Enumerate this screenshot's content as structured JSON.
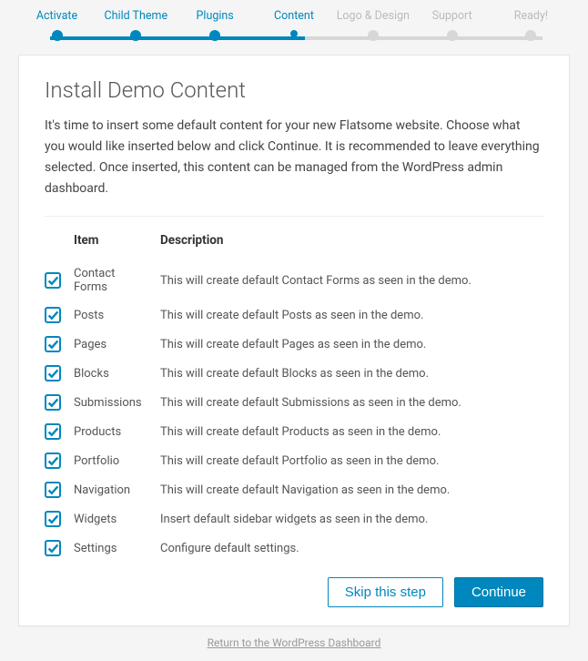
{
  "steps": [
    {
      "label": "Activate",
      "state": "done"
    },
    {
      "label": "Child Theme",
      "state": "done"
    },
    {
      "label": "Plugins",
      "state": "done"
    },
    {
      "label": "Content",
      "state": "active"
    },
    {
      "label": "Logo & Design",
      "state": "pending"
    },
    {
      "label": "Support",
      "state": "pending"
    },
    {
      "label": "Ready!",
      "state": "pending"
    }
  ],
  "title": "Install Demo Content",
  "intro": "It's time to insert some default content for your new Flatsome website. Choose what you would like inserted below and click Continue. It is recommended to leave everything selected. Once inserted, this content can be managed from the WordPress admin dashboard.",
  "table": {
    "headers": {
      "item": "Item",
      "description": "Description"
    },
    "rows": [
      {
        "checked": true,
        "item": "Contact Forms",
        "description": "This will create default Contact Forms as seen in the demo."
      },
      {
        "checked": true,
        "item": "Posts",
        "description": "This will create default Posts as seen in the demo."
      },
      {
        "checked": true,
        "item": "Pages",
        "description": "This will create default Pages as seen in the demo."
      },
      {
        "checked": true,
        "item": "Blocks",
        "description": "This will create default Blocks as seen in the demo."
      },
      {
        "checked": true,
        "item": "Submissions",
        "description": "This will create default Submissions as seen in the demo."
      },
      {
        "checked": true,
        "item": "Products",
        "description": "This will create default Products as seen in the demo."
      },
      {
        "checked": true,
        "item": "Portfolio",
        "description": "This will create default Portfolio as seen in the demo."
      },
      {
        "checked": true,
        "item": "Navigation",
        "description": "This will create default Navigation as seen in the demo."
      },
      {
        "checked": true,
        "item": "Widgets",
        "description": "Insert default sidebar widgets as seen in the demo."
      },
      {
        "checked": true,
        "item": "Settings",
        "description": "Configure default settings."
      }
    ]
  },
  "actions": {
    "skip": "Skip this step",
    "continue": "Continue"
  },
  "footer": "Return to the WordPress Dashboard"
}
